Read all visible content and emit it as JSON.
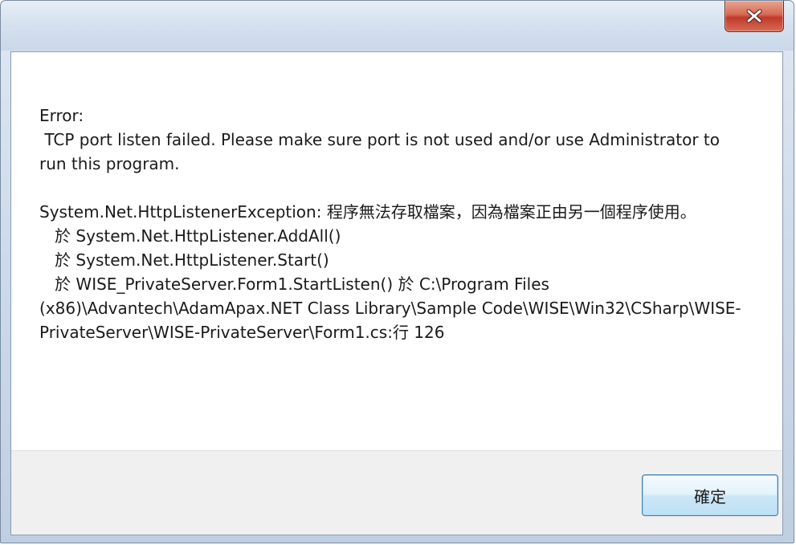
{
  "window": {
    "title": ""
  },
  "titlebar": {
    "close_icon": "close-x-icon",
    "close_color": "#c0392b"
  },
  "message": {
    "text": "Error:\n TCP port listen failed. Please make sure port is not used and/or use Administrator to run this program.\n\nSystem.Net.HttpListenerException: 程序無法存取檔案，因為檔案正由另一個程序使用。\n   於 System.Net.HttpListener.AddAll()\n   於 System.Net.HttpListener.Start()\n   於 WISE_PrivateServer.Form1.StartListen() 於 C:\\Program Files (x86)\\Advantech\\AdamApax.NET Class Library\\Sample Code\\WISE\\Win32\\CSharp\\WISE-PrivateServer\\WISE-PrivateServer\\Form1.cs:行 126"
  },
  "buttons": {
    "ok_label": "確定"
  }
}
